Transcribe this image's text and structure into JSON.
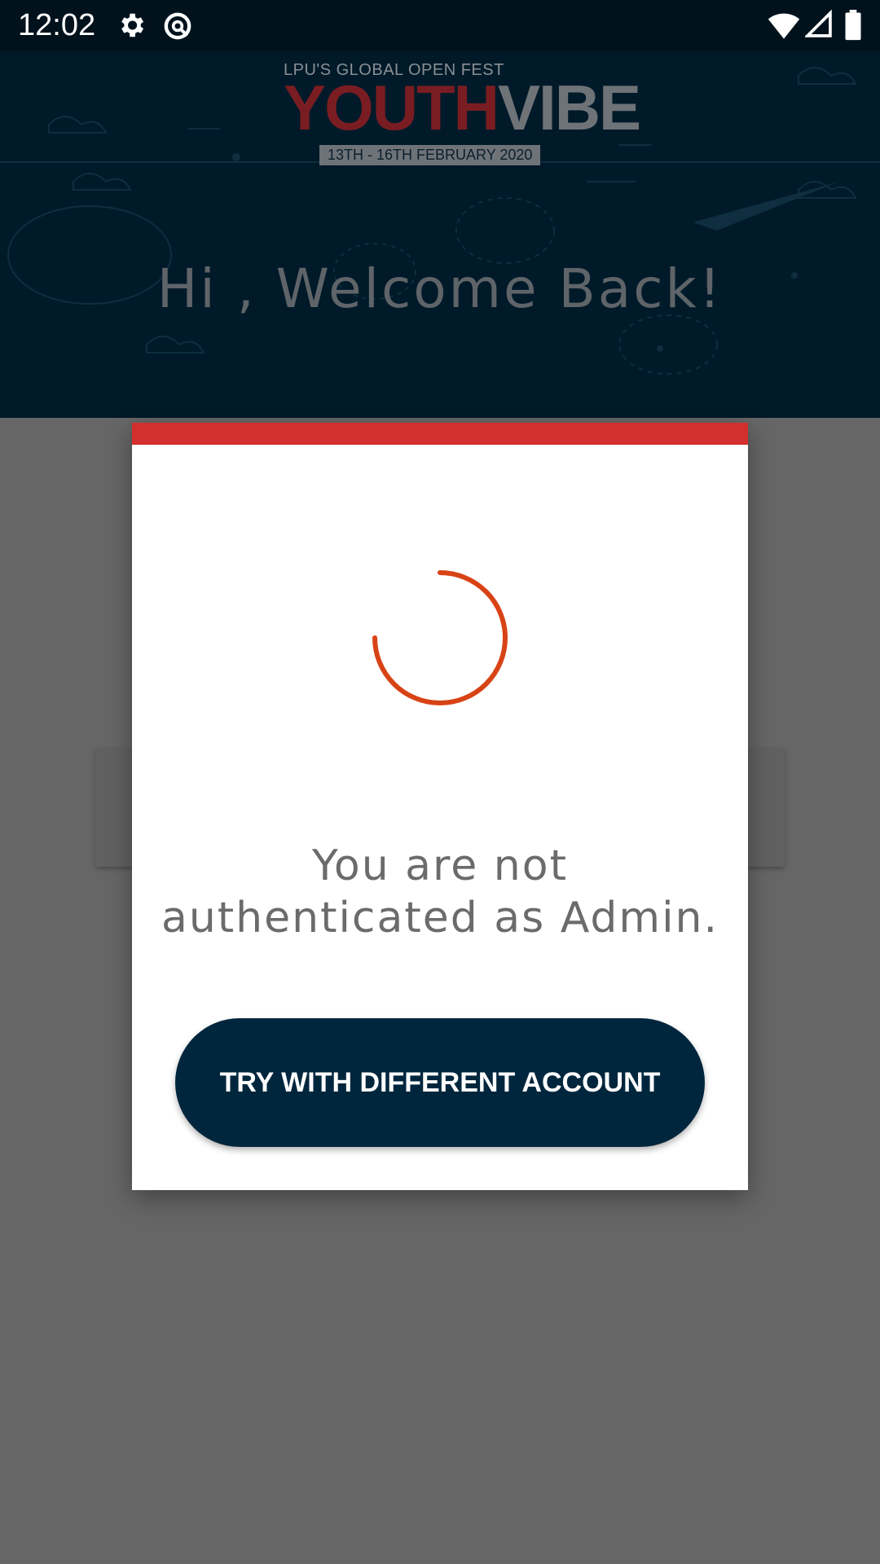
{
  "status_bar": {
    "time": "12:02",
    "icons": [
      "settings-icon",
      "data-saver-icon",
      "wifi-icon",
      "cellular-signal-icon",
      "battery-icon"
    ]
  },
  "header": {
    "logo": {
      "subtitle": "LPU'S GLOBAL OPEN FEST",
      "title_part1": "YOUTH",
      "title_part2": "VIBE",
      "dates": "13TH - 16TH FEBRUARY 2020"
    },
    "welcome": "Hi , Welcome Back!"
  },
  "dialog": {
    "accent_color": "#d32f2f",
    "spinner_color": "#d84315",
    "message": "You are not authenticated as Admin.",
    "button_label": "TRY WITH DIFFERENT ACCOUNT",
    "button_color": "#00263d"
  }
}
